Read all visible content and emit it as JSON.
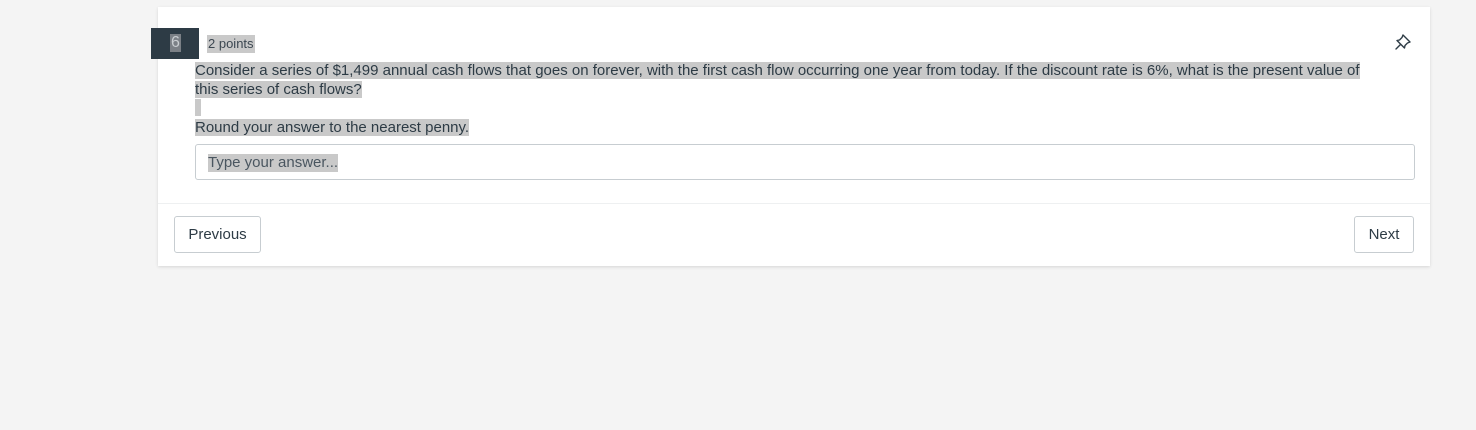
{
  "question": {
    "number": "6",
    "points": "2 points",
    "text_line1": "Consider a series of $1,499 annual cash flows that goes on forever, with the first cash flow occurring one year from today. If the discount rate is 6%, what is the present value of",
    "text_line2": "this series of cash flows?",
    "instruction": "Round your answer to the nearest penny.",
    "pin_icon": "pin-icon"
  },
  "answer": {
    "placeholder": "Type your answer..."
  },
  "navigation": {
    "previous_label": "Previous",
    "next_label": "Next"
  },
  "colors": {
    "background": "#f4f4f4",
    "card": "#ffffff",
    "question_badge": "#2d3b45",
    "highlight": "#c9c9c9",
    "text": "#2d3b45"
  }
}
